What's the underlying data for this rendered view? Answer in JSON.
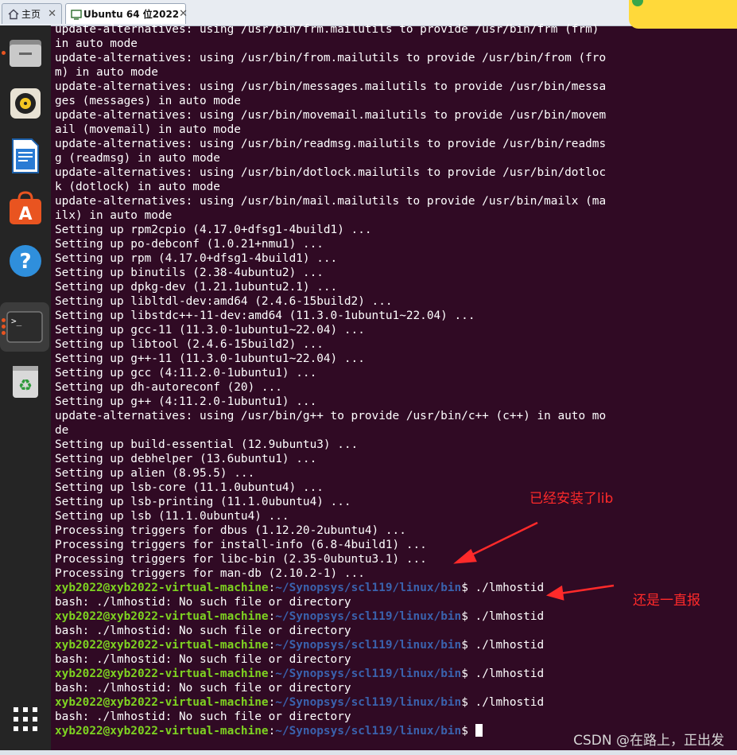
{
  "tabs": [
    {
      "label": "主页",
      "icon": "home-icon"
    },
    {
      "label": "Ubuntu 64 位2022",
      "icon": "vm-icon"
    }
  ],
  "dock": [
    {
      "name": "files-icon"
    },
    {
      "name": "rhythmbox-icon"
    },
    {
      "name": "writer-icon"
    },
    {
      "name": "software-icon"
    },
    {
      "name": "help-icon"
    },
    {
      "name": "terminal-icon"
    },
    {
      "name": "trash-icon"
    },
    {
      "name": "apps-grid-icon"
    }
  ],
  "terminal": {
    "prompt_user": "xyb2022@xyb2022-virtual-machine",
    "prompt_path": "~/Synopsys/scl119/linux/bin",
    "lines": [
      "update-alternatives: using /usr/bin/frm.mailutils to provide /usr/bin/frm (frm)",
      "in auto mode",
      "update-alternatives: using /usr/bin/from.mailutils to provide /usr/bin/from (fro",
      "m) in auto mode",
      "update-alternatives: using /usr/bin/messages.mailutils to provide /usr/bin/messa",
      "ges (messages) in auto mode",
      "update-alternatives: using /usr/bin/movemail.mailutils to provide /usr/bin/movem",
      "ail (movemail) in auto mode",
      "update-alternatives: using /usr/bin/readmsg.mailutils to provide /usr/bin/readms",
      "g (readmsg) in auto mode",
      "update-alternatives: using /usr/bin/dotlock.mailutils to provide /usr/bin/dotloc",
      "k (dotlock) in auto mode",
      "update-alternatives: using /usr/bin/mail.mailutils to provide /usr/bin/mailx (ma",
      "ilx) in auto mode",
      "Setting up rpm2cpio (4.17.0+dfsg1-4build1) ...",
      "Setting up po-debconf (1.0.21+nmu1) ...",
      "Setting up rpm (4.17.0+dfsg1-4build1) ...",
      "Setting up binutils (2.38-4ubuntu2) ...",
      "Setting up dpkg-dev (1.21.1ubuntu2.1) ...",
      "Setting up libltdl-dev:amd64 (2.4.6-15build2) ...",
      "Setting up libstdc++-11-dev:amd64 (11.3.0-1ubuntu1~22.04) ...",
      "Setting up gcc-11 (11.3.0-1ubuntu1~22.04) ...",
      "Setting up libtool (2.4.6-15build2) ...",
      "Setting up g++-11 (11.3.0-1ubuntu1~22.04) ...",
      "Setting up gcc (4:11.2.0-1ubuntu1) ...",
      "Setting up dh-autoreconf (20) ...",
      "Setting up g++ (4:11.2.0-1ubuntu1) ...",
      "update-alternatives: using /usr/bin/g++ to provide /usr/bin/c++ (c++) in auto mo",
      "de",
      "Setting up build-essential (12.9ubuntu3) ...",
      "Setting up debhelper (13.6ubuntu1) ...",
      "Setting up alien (8.95.5) ...",
      "Setting up lsb-core (11.1.0ubuntu4) ...",
      "Setting up lsb-printing (11.1.0ubuntu4) ...",
      "Setting up lsb (11.1.0ubuntu4) ...",
      "Processing triggers for dbus (1.12.20-2ubuntu4) ...",
      "Processing triggers for install-info (6.8-4build1) ...",
      "Processing triggers for libc-bin (2.35-0ubuntu3.1) ...",
      "Processing triggers for man-db (2.10.2-1) ..."
    ],
    "sessions": [
      {
        "command": "./lmhostid",
        "output": "bash: ./lmhostid: No such file or directory"
      },
      {
        "command": "./lmhostid",
        "output": "bash: ./lmhostid: No such file or directory"
      },
      {
        "command": "./lmhostid",
        "output": "bash: ./lmhostid: No such file or directory"
      },
      {
        "command": "./lmhostid",
        "output": "bash: ./lmhostid: No such file or directory"
      },
      {
        "command": "./lmhostid",
        "output": "bash: ./lmhostid: No such file or directory"
      }
    ]
  },
  "annotations": {
    "note1": "已经安装了lib",
    "note2": "还是一直报",
    "color": "#ff2a2a"
  },
  "watermark": "CSDN @在路上，正出发"
}
